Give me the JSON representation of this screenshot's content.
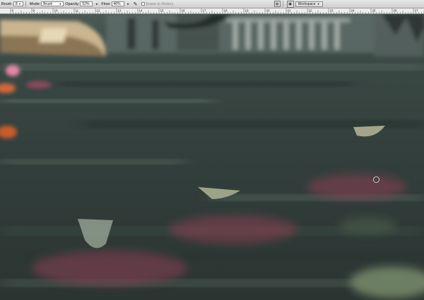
{
  "options_bar": {
    "brush_label": "Brush:",
    "brush_size": "8",
    "mode_label": "Mode:",
    "mode_value": "Brush",
    "opacity_label": "Opacity:",
    "opacity_value": "52%",
    "flow_label": "Flow:",
    "flow_value": "46%",
    "erase_to_history_label": "Erase to History",
    "workspace_label": "Workspace"
  },
  "icons": {
    "brush_tool": "brush-tool-icon",
    "airbrush": "airbrush-icon",
    "palette": "palette-icon",
    "workspace_dropdown": "chevron-down-icon"
  },
  "ruler": {
    "ticks": [
      "8",
      "9",
      "10",
      "11",
      "12",
      "13",
      "14",
      "15",
      "16",
      "17",
      "18",
      "19",
      "20",
      "21",
      "22",
      "23",
      "24",
      "25",
      "26",
      "27"
    ]
  },
  "colors": {
    "water": "#3c4a45",
    "lotus_petal": "#b8465f",
    "lotus_center": "#e7a62a"
  }
}
